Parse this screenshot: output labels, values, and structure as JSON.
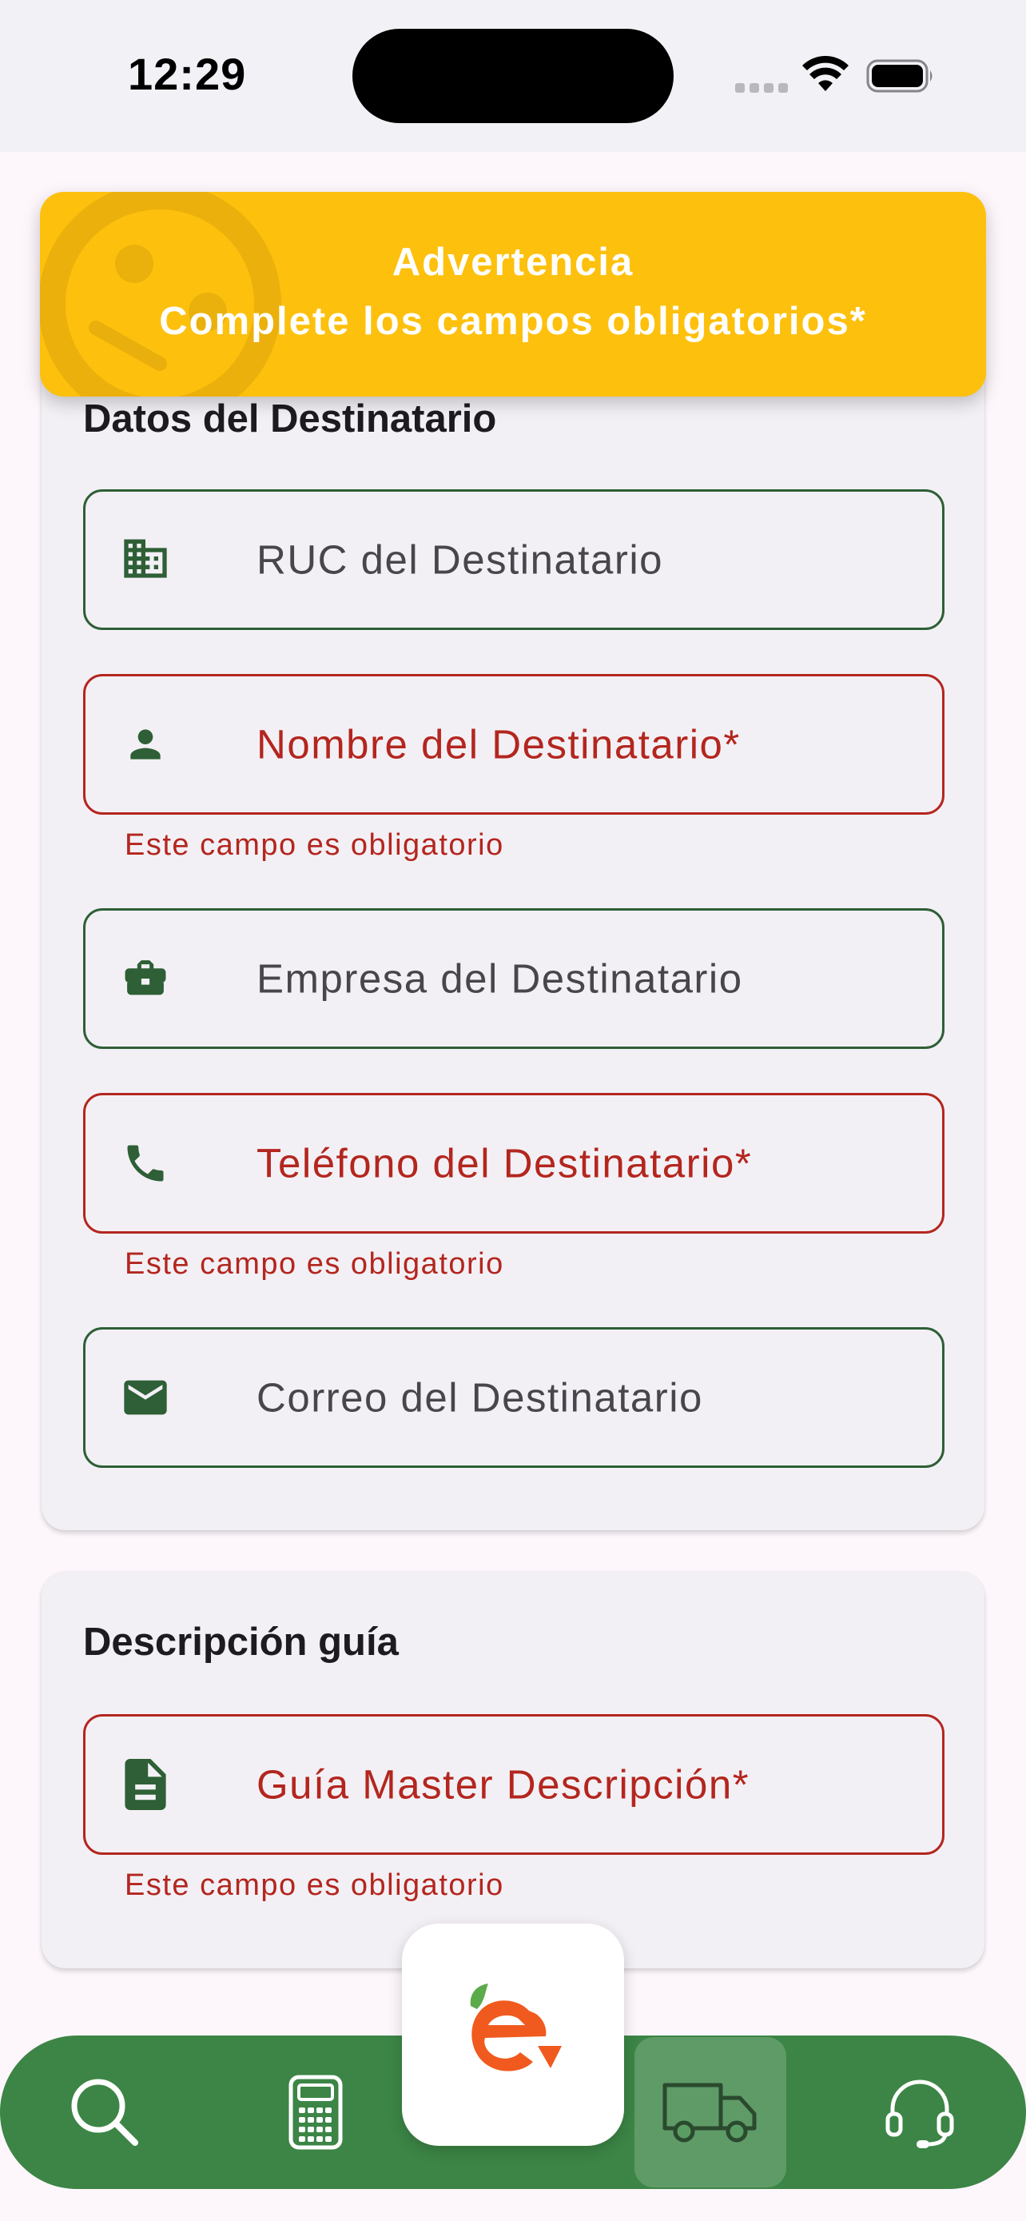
{
  "status_bar": {
    "time": "12:29"
  },
  "toast": {
    "title": "Advertencia",
    "message": "Complete los campos obligatorios*",
    "color": "#FDC00D"
  },
  "recipient_section": {
    "title": "Datos del Destinatario",
    "fields": [
      {
        "label": "RUC del Destinatario",
        "icon": "business-icon",
        "error": false
      },
      {
        "label": "Nombre del Destinatario*",
        "icon": "person-icon",
        "error": true,
        "helper": "Este campo es obligatorio"
      },
      {
        "label": "Empresa del Destinatario",
        "icon": "briefcase-icon",
        "error": false
      },
      {
        "label": "Teléfono del Destinatario*",
        "icon": "phone-icon",
        "error": true,
        "helper": "Este campo es obligatorio"
      },
      {
        "label": "Correo del Destinatario",
        "icon": "mail-icon",
        "error": false
      }
    ]
  },
  "guide_section": {
    "title": "Descripción guía",
    "fields": [
      {
        "label": "Guía Master Descripción*",
        "icon": "document-icon",
        "error": true,
        "helper": "Este campo es obligatorio"
      }
    ]
  },
  "bottom_nav": {
    "items": [
      {
        "icon": "search-icon",
        "active": false
      },
      {
        "icon": "calculator-icon",
        "active": false
      },
      {
        "icon": "app-logo-icon",
        "active": false
      },
      {
        "icon": "truck-icon",
        "active": true
      },
      {
        "icon": "headset-icon",
        "active": false
      }
    ],
    "background": "#3C8546"
  },
  "colors": {
    "primary_green": "#2E5F36",
    "error_red": "#B3261E",
    "logo_orange": "#F05A1E"
  }
}
